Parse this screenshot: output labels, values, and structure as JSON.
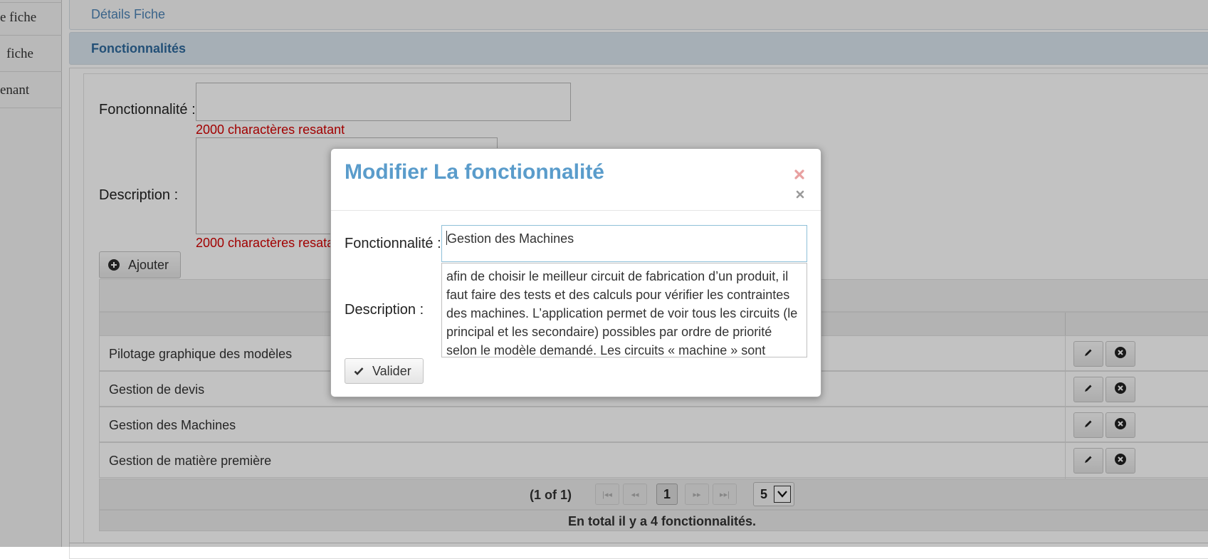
{
  "sidebar": {
    "items": [
      {
        "label": "e fiche"
      },
      {
        "label": "fiche"
      },
      {
        "label": "enant"
      }
    ]
  },
  "panels": {
    "details_title": "Détails Fiche",
    "functionalities_title": "Fonctionnalités"
  },
  "form": {
    "functionality_label": "Fonctionnalité :",
    "functionality_counter": "2000 charactères resatant",
    "description_label": "Description :",
    "description_counter": "2000 charactères resatant",
    "add_button_label": "Ajouter"
  },
  "table": {
    "rows": [
      {
        "name": "Pilotage graphique des modèles"
      },
      {
        "name": "Gestion de devis"
      },
      {
        "name": "Gestion des Machines"
      },
      {
        "name": "Gestion de matière première"
      }
    ],
    "pager": {
      "page_info": "(1 of 1)",
      "current_page": "1",
      "rows_per_page": "5"
    },
    "footer_text": "En total il y a 4 fonctionnalités."
  },
  "dialog": {
    "title": "Modifier La fonctionnalité",
    "functionality_label": "Fonctionnalité :",
    "functionality_value": "Gestion des Machines",
    "description_label": "Description :",
    "description_value": "afin de choisir le meilleur circuit de fabrication d’un produit, il faut faire des tests et des calculs pour vérifier les contraintes des machines. L’application permet de voir tous les circuits (le principal et les secondaire) possibles par ordre de priorité selon le modèle demandé. Les circuits « machine » sont décrits en",
    "submit_label": "Valider"
  },
  "icons": {
    "close": "close-icon",
    "edit": "pencil-icon",
    "delete": "delete-circle-icon",
    "add": "plus-circle-icon",
    "check": "check-icon"
  },
  "colors": {
    "accent": "#5a9ccb",
    "counter": "#d40000",
    "close_red": "#e8a0a0"
  }
}
